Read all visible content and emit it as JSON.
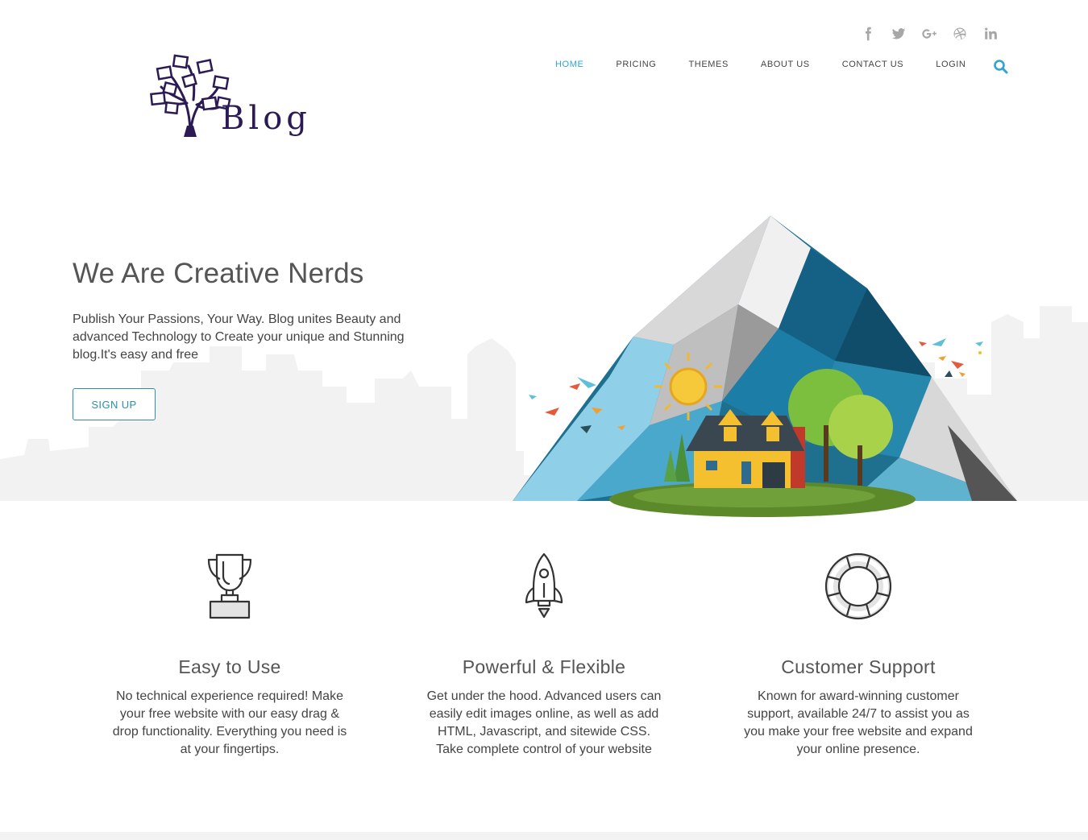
{
  "social": [
    {
      "name": "facebook-icon",
      "glyph": "f"
    },
    {
      "name": "twitter-icon",
      "glyph": "t"
    },
    {
      "name": "google-plus-icon",
      "glyph": "g+"
    },
    {
      "name": "dribbble-icon",
      "glyph": "d"
    },
    {
      "name": "linkedin-icon",
      "glyph": "in"
    }
  ],
  "brand": {
    "name": "Blog",
    "color": "#2c1a55"
  },
  "nav": {
    "items": [
      {
        "label": "HOME",
        "active": true
      },
      {
        "label": "PRICING",
        "active": false
      },
      {
        "label": "THEMES",
        "active": false
      },
      {
        "label": "ABOUT US",
        "active": false
      },
      {
        "label": "CONTACT US",
        "active": false
      },
      {
        "label": "LOGIN",
        "active": false
      }
    ],
    "accent": "#31a4cf"
  },
  "hero": {
    "title": "We Are Creative Nerds",
    "subtitle": "Publish Your Passions, Your Way. Blog unites Beauty and advanced Technology to Create your unique and Stunning blog.It's easy and free",
    "cta": "SIGN UP"
  },
  "features": [
    {
      "icon": "trophy-icon",
      "title": "Easy to Use",
      "text": "No technical experience required! Make your free website with our easy drag & drop functionality. Everything you need is at your fingertips."
    },
    {
      "icon": "rocket-icon",
      "title": "Powerful & Flexible",
      "text": "Get under the hood. Advanced users can easily edit images online, as well as add HTML, Javascript, and sitewide CSS. Take complete control of your website"
    },
    {
      "icon": "lifebuoy-icon",
      "title": "Customer Support",
      "text": "Known for award-winning customer support, available 24/7 to assist you as you make your free website and expand your online presence."
    }
  ]
}
